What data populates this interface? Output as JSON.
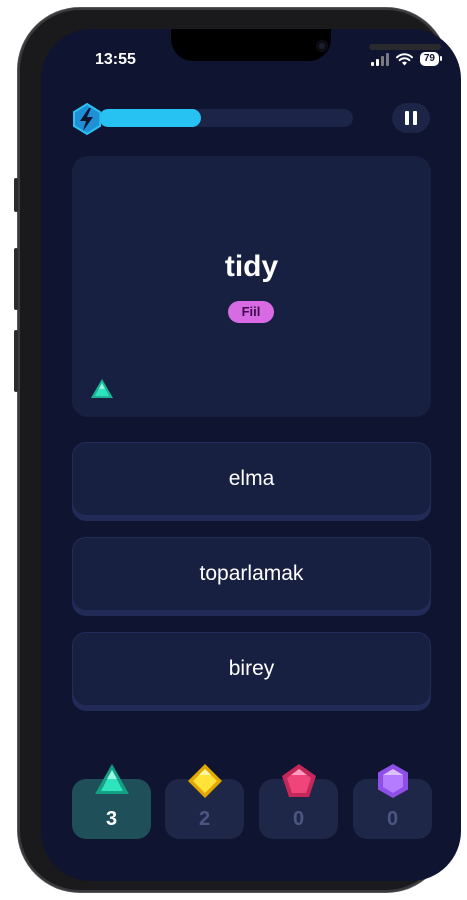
{
  "status_bar": {
    "time": "13:55",
    "battery": "79"
  },
  "progress": {
    "fraction": 0.4
  },
  "word_card": {
    "word": "tidy",
    "part_of_speech": "Fiil",
    "gem": "green-triangle-gem-icon"
  },
  "options": [
    {
      "label": "elma"
    },
    {
      "label": "toparlamak"
    },
    {
      "label": "birey"
    }
  ],
  "counters": [
    {
      "gem": "green-triangle-gem-icon",
      "color": "#2fd3b0",
      "count": "3",
      "active": true
    },
    {
      "gem": "yellow-diamond-gem-icon",
      "color": "#ffe23a",
      "count": "2",
      "active": false
    },
    {
      "gem": "pink-pentagon-gem-icon",
      "color": "#f0457a",
      "count": "0",
      "active": false
    },
    {
      "gem": "purple-hexagon-gem-icon",
      "color": "#b57cff",
      "count": "0",
      "active": false
    }
  ],
  "colors": {
    "background": "#0f1430",
    "card": "#182042",
    "accent": "#27c1f2",
    "badge": "#d86be3"
  }
}
